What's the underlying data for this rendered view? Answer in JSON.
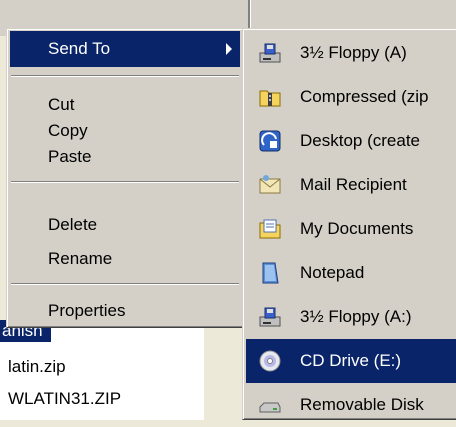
{
  "context_menu": {
    "send_to": "Send To",
    "cut": "Cut",
    "copy": "Copy",
    "paste": "Paste",
    "delete": "Delete",
    "rename": "Rename",
    "properties": "Properties"
  },
  "send_to_menu": {
    "items": [
      {
        "label": "3½ Floppy (A)",
        "icon": "floppy-drive-icon"
      },
      {
        "label": "Compressed (zip",
        "icon": "zip-folder-icon"
      },
      {
        "label": "Desktop (create",
        "icon": "desktop-shortcut-icon"
      },
      {
        "label": "Mail Recipient",
        "icon": "mail-envelope-icon"
      },
      {
        "label": "My Documents",
        "icon": "my-documents-folder-icon"
      },
      {
        "label": "Notepad",
        "icon": "notepad-icon"
      },
      {
        "label": "3½ Floppy (A:)",
        "icon": "floppy-drive-icon"
      },
      {
        "label": "CD Drive (E:)",
        "icon": "cd-drive-icon"
      },
      {
        "label": "Removable Disk",
        "icon": "removable-disk-icon"
      }
    ]
  },
  "file_list": {
    "items": [
      "anish",
      "latin.zip",
      "WLATIN31.ZIP"
    ]
  },
  "colors": {
    "menu_face": "#d4d0c8",
    "highlight": "#0a246a",
    "highlight_text": "#ffffff"
  }
}
